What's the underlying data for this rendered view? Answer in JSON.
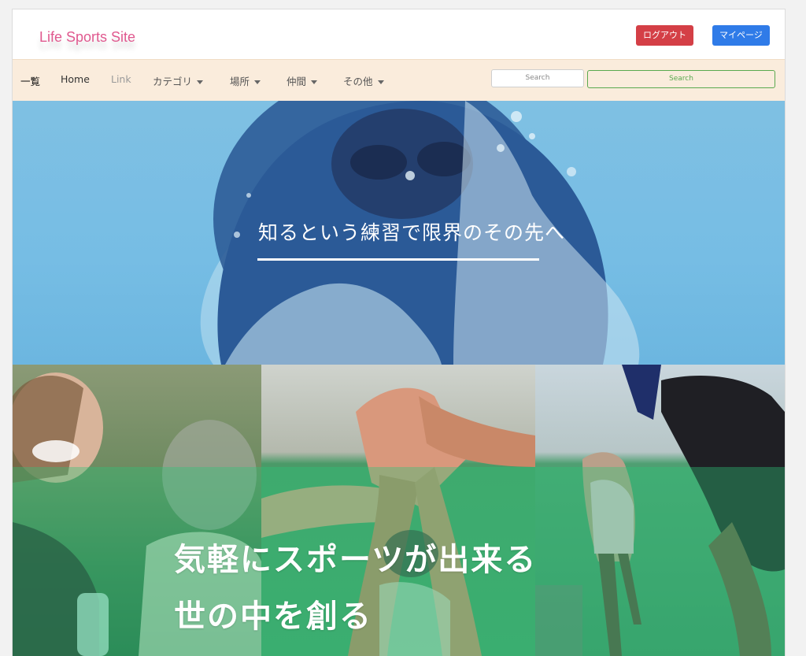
{
  "header": {
    "brand": "Life Sports Site",
    "logout_label": "ログアウト",
    "mypage_label": "マイページ"
  },
  "nav": {
    "brand": "一覧",
    "home": "Home",
    "link": "Link",
    "dropdowns": [
      "カテゴリ",
      "場所",
      "仲間",
      "その他"
    ],
    "search_placeholder": "Search",
    "search_button": "Search"
  },
  "hero1": {
    "caption": "知るという練習で限界のその先へ"
  },
  "hero2": {
    "line1": "気軽にスポーツが出来る",
    "line2": "世の中を創る"
  },
  "colors": {
    "brand": "#e0598f",
    "logout": "#d43f46",
    "mypage": "#2f7be8",
    "navbar": "#faecdc",
    "search_button": "#5aa94f"
  }
}
